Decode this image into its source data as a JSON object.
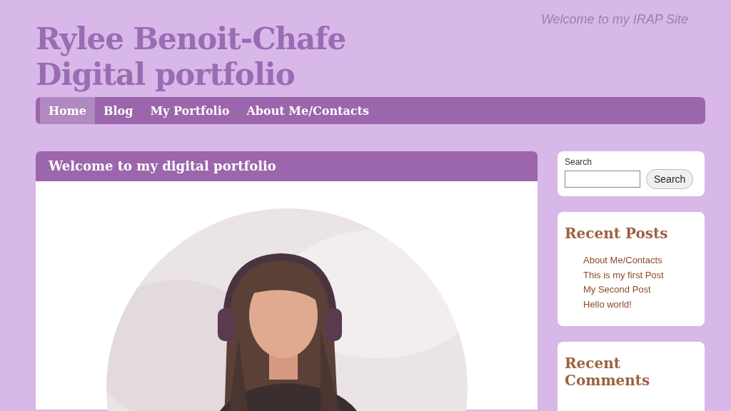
{
  "site": {
    "title": "Rylee Benoit-Chafe Digital portfolio",
    "tagline": "Welcome to my IRAP Site"
  },
  "nav": [
    {
      "label": "Home",
      "selected": true
    },
    {
      "label": "Blog",
      "selected": false
    },
    {
      "label": "My Portfolio",
      "selected": false
    },
    {
      "label": "About Me/Contacts",
      "selected": false
    }
  ],
  "main": {
    "title": "Welcome to my digital portfolio"
  },
  "sidebar": {
    "search": {
      "label": "Search",
      "button": "Search"
    },
    "recent_posts": {
      "heading": "Recent Posts",
      "items": [
        "About Me/Contacts",
        "This is my first Post",
        "My Second Post",
        "Hello world!"
      ]
    },
    "recent_comments": {
      "heading": "Recent Comments"
    }
  }
}
